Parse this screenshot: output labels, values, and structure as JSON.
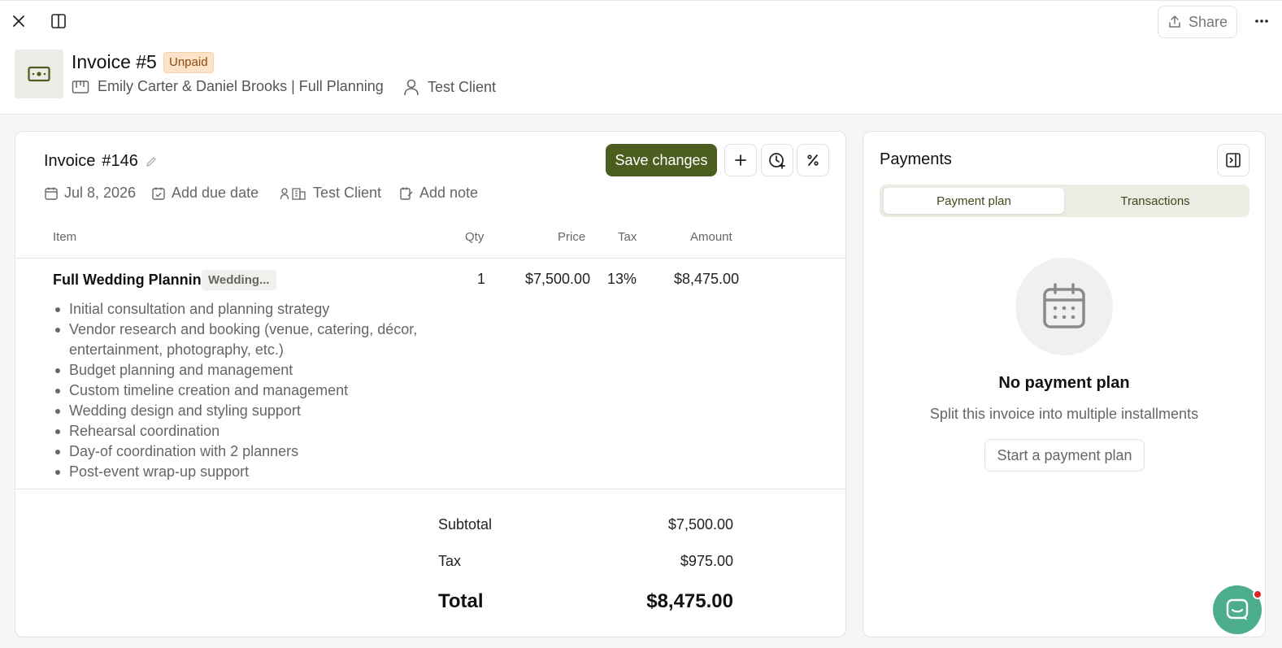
{
  "header": {
    "close_icon": "close-icon",
    "panel_icon": "panel-icon",
    "share_label": "Share",
    "more_icon": "ellipsis-icon",
    "title": "Invoice #5",
    "status": "Unpaid",
    "project": "Emily Carter & Daniel Brooks | Full Planning",
    "client": "Test Client"
  },
  "invoice": {
    "title": "Invoice",
    "number": "#146",
    "save_label": "Save changes",
    "date": "Jul 8, 2026",
    "due_date": "Add due date",
    "client": "Test Client",
    "note": "Add note",
    "columns": {
      "item": "Item",
      "qty": "Qty",
      "price": "Price",
      "tax": "Tax",
      "amount": "Amount"
    },
    "line_item": {
      "name": "Full Wedding Planning",
      "tag": "Wedding...",
      "qty": "1",
      "price": "$7,500.00",
      "tax": "13%",
      "amount": "$8,475.00",
      "bullets": [
        "Initial consultation and planning strategy",
        "Vendor research and booking (venue, catering, décor, entertainment, photography, etc.)",
        "Budget planning and management",
        "Custom timeline creation and management",
        "Wedding design and styling support",
        "Rehearsal coordination",
        "Day-of coordination with 2 planners",
        "Post-event wrap-up support"
      ]
    },
    "summary": {
      "subtotal_label": "Subtotal",
      "subtotal": "$7,500.00",
      "tax_label": "Tax",
      "tax": "$975.00",
      "total_label": "Total",
      "total": "$8,475.00"
    }
  },
  "payments": {
    "title": "Payments",
    "tabs": [
      "Payment plan",
      "Transactions"
    ],
    "active_tab": "Payment plan",
    "empty_title": "No payment plan",
    "empty_subtitle": "Split this invoice into multiple installments",
    "start_label": "Start a payment plan"
  },
  "colors": {
    "accent": "#4b5e1f",
    "badge_bg": "#fde3c8",
    "chat": "#4cae8e"
  }
}
